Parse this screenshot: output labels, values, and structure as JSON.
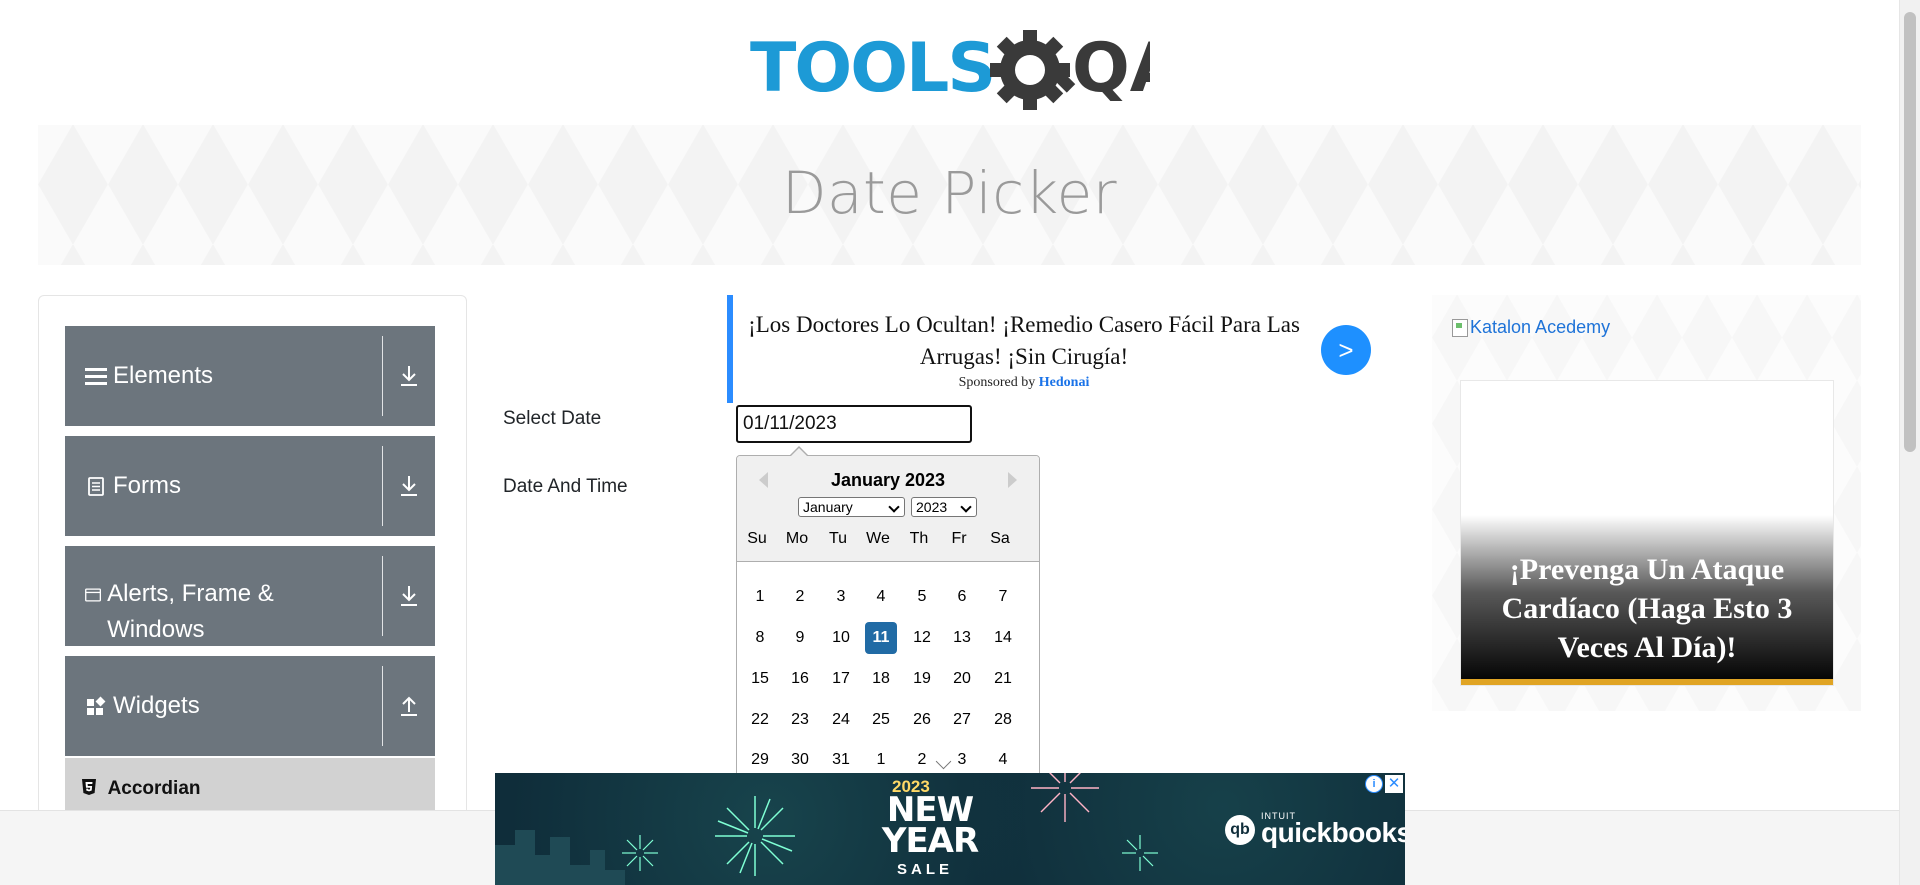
{
  "logo": {
    "text_part1": "TOOLS",
    "text_part2": "QA"
  },
  "banner": {
    "title": "Date Picker"
  },
  "sidebar": {
    "groups": [
      {
        "label": "Elements",
        "icon": "hamburger-icon",
        "arrow": "download-arrow-icon"
      },
      {
        "label": "Forms",
        "icon": "document-icon",
        "arrow": "download-arrow-icon"
      },
      {
        "label": "Alerts, Frame & Windows",
        "icon": "window-icon",
        "arrow": "download-arrow-icon"
      },
      {
        "label": "Widgets",
        "icon": "widgets-icon",
        "arrow": "upload-arrow-icon"
      }
    ],
    "sub_items": [
      {
        "label": "Accordian",
        "icon": "html5-icon"
      }
    ]
  },
  "form": {
    "select_date_label": "Select Date",
    "select_date_value": "01/11/2023",
    "date_time_label": "Date And Time"
  },
  "calendar": {
    "month_title": "January 2023",
    "month_select": "January",
    "year_select": "2023",
    "weekdays": [
      "Su",
      "Mo",
      "Tu",
      "We",
      "Th",
      "Fr",
      "Sa"
    ],
    "weeks": [
      [
        "1",
        "2",
        "3",
        "4",
        "5",
        "6",
        "7"
      ],
      [
        "8",
        "9",
        "10",
        "11",
        "12",
        "13",
        "14"
      ],
      [
        "15",
        "16",
        "17",
        "18",
        "19",
        "20",
        "21"
      ],
      [
        "22",
        "23",
        "24",
        "25",
        "26",
        "27",
        "28"
      ],
      [
        "29",
        "30",
        "31",
        "1",
        "2",
        "3",
        "4"
      ]
    ],
    "selected_day": "11"
  },
  "ad_top": {
    "headline": "¡Los Doctores Lo Ocultan! ¡Remedio Casero Fácil Para Las Arrugas! ¡Sin Cirugía!",
    "sponsored_prefix": "Sponsored by",
    "sponsor": "Hedonai",
    "button_label": ">"
  },
  "ad_right": {
    "image_alt": "Katalon Acedemy",
    "card_title": "¡Prevenga Un Ataque Cardíaco (Haga Esto 3 Veces Al Día)!"
  },
  "ad_bottom": {
    "year": "2023",
    "headline_line1": "NEW",
    "headline_line2": "YEAR",
    "sale": "SALE",
    "brand_small": "INTUIT",
    "brand": "quickbooks",
    "adchoices": "i",
    "close": "✕"
  },
  "colors": {
    "logo_blue": "#1d9ad6",
    "logo_dark": "#3a3a3a",
    "sidebar_gray": "#6c757d",
    "selected_day": "#216ba5",
    "ad_button": "#1e90ff"
  }
}
